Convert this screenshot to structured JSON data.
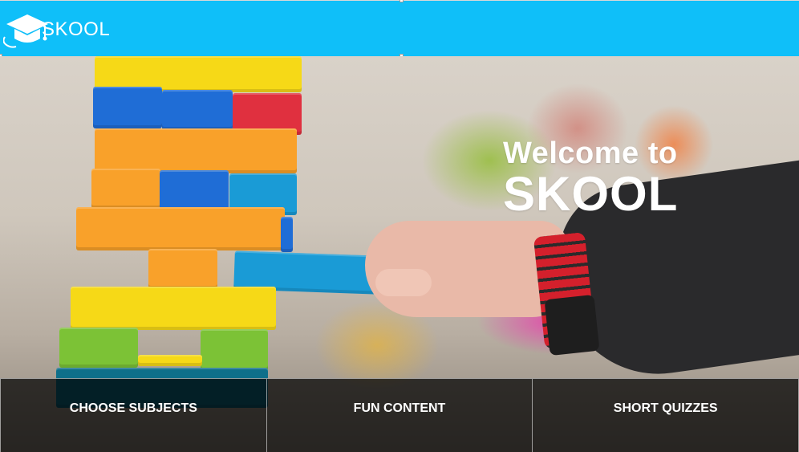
{
  "header": {
    "logo_text": "SKOOL",
    "logo_icon": "graduation-cap-icon",
    "background_color": "#0fbff9"
  },
  "hero": {
    "title_line1": "Welcome to",
    "title_line2": "SKOOL",
    "image": "jenga-blocks-photo"
  },
  "nav": {
    "items": [
      {
        "label": "CHOOSE SUBJECTS"
      },
      {
        "label": "FUN CONTENT"
      },
      {
        "label": "SHORT QUIZZES"
      }
    ]
  }
}
